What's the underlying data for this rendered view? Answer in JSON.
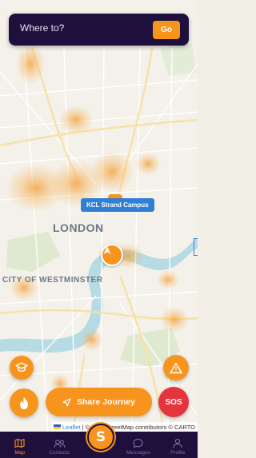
{
  "search": {
    "placeholder": "Where to?",
    "go_label": "Go"
  },
  "map": {
    "city_label": "LONDON",
    "district_label": "CITY OF WESTMINSTER",
    "campus_label": "KCL Strand Campus"
  },
  "actions": {
    "share_label": "Share Journey",
    "sos_label": "SOS"
  },
  "attribution": {
    "leaflet": "Leaflet",
    "separator": "|",
    "text": "© OpenStreetMap contributors © CARTO"
  },
  "nav": {
    "items": [
      {
        "label": "Map",
        "icon": "map-icon",
        "active": true
      },
      {
        "label": "Contacts",
        "icon": "contacts-icon",
        "active": false
      },
      {
        "label": "S",
        "icon": "app-logo",
        "active": false
      },
      {
        "label": "Messages",
        "icon": "messages-icon",
        "active": false
      },
      {
        "label": "Profile",
        "icon": "profile-icon",
        "active": false
      }
    ]
  },
  "colors": {
    "brand_dark": "#1e0f3c",
    "accent": "#f7941d",
    "danger": "#e5343d",
    "marker_blue": "#2f7fd6"
  }
}
